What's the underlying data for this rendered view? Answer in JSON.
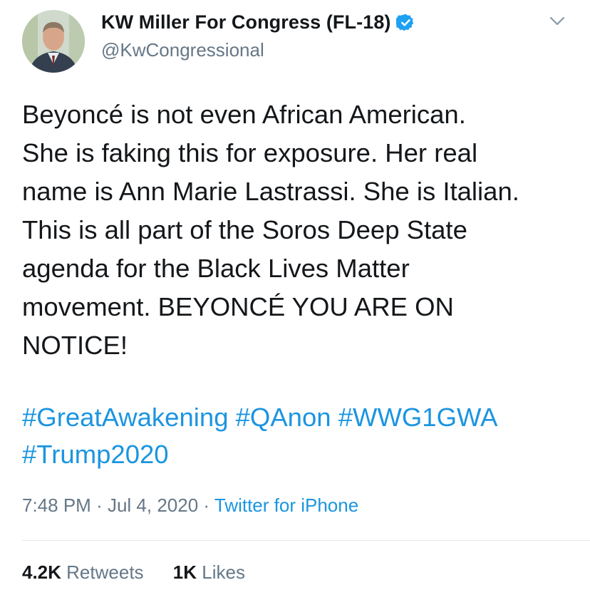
{
  "user": {
    "display_name": "KW Miller For Congress (FL-18)",
    "handle": "@KwCongressional",
    "verified_icon": "verified-badge-icon"
  },
  "tweet": {
    "text_lines": [
      "Beyoncé is not even African American.",
      "She is faking this for exposure. Her real",
      "name is Ann Marie Lastrassi. She is Italian.",
      "This is all part of the Soros Deep State",
      "agenda for the Black Lives Matter",
      "movement. BEYONCÉ YOU ARE ON",
      "NOTICE!"
    ],
    "hashtag_lines": [
      "#GreatAwakening #QAnon #WWG1GWA",
      "#Trump2020"
    ]
  },
  "meta": {
    "time": "7:48 PM",
    "separator": "·",
    "date": "Jul 4, 2020",
    "source": "Twitter for iPhone"
  },
  "stats": {
    "retweets_count": "4.2K",
    "retweets_label": "Retweets",
    "likes_count": "1K",
    "likes_label": "Likes"
  },
  "colors": {
    "link": "#1b95e0",
    "secondary_text": "#657786",
    "primary_text": "#14171a",
    "divider": "#e1e8ed"
  }
}
